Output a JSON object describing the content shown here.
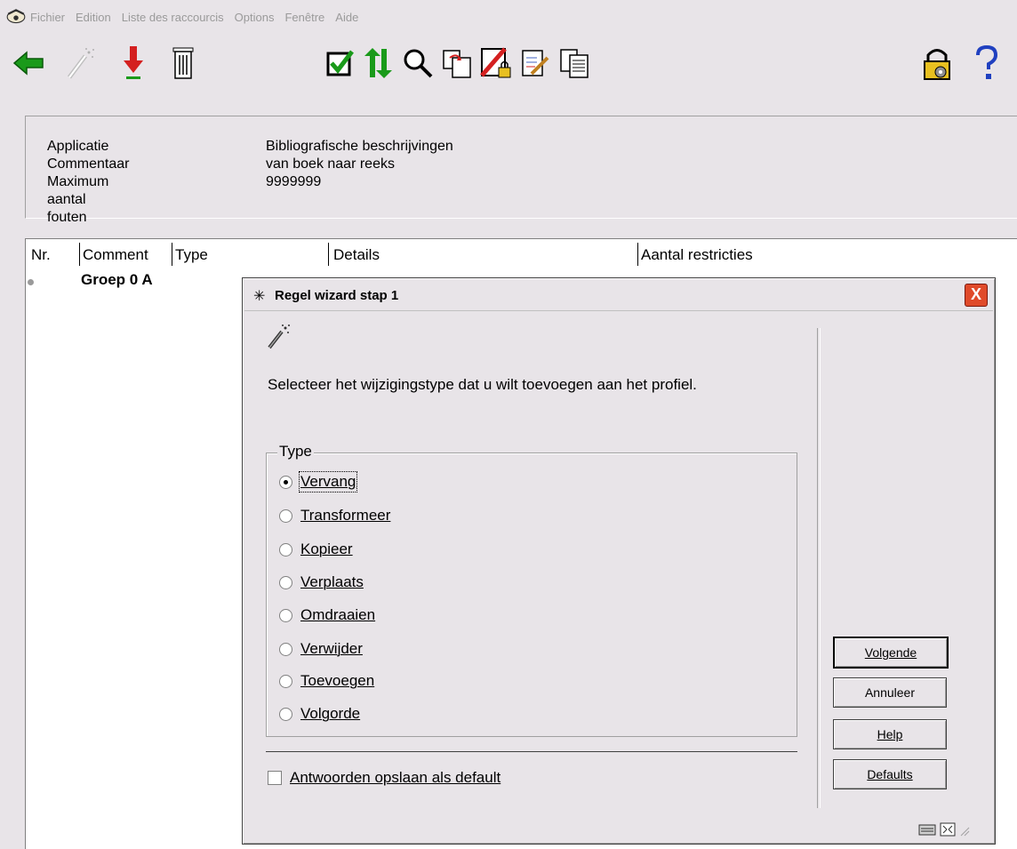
{
  "menubar": {
    "items": [
      "Fichier",
      "Edition",
      "Liste des raccourcis",
      "Options",
      "Fenêtre",
      "Aide"
    ]
  },
  "toolbar": {
    "left_icons": [
      "back-arrow-icon",
      "magic-wand-icon",
      "download-arrow-icon",
      "trash-icon"
    ],
    "center_icons": [
      "checkmark-icon",
      "sort-updown-icon",
      "search-icon",
      "copy-pages-icon",
      "lock-edit-icon",
      "edit-note-icon",
      "document-list-icon"
    ],
    "right_icons": [
      "lock-settings-icon",
      "help-icon"
    ]
  },
  "header": {
    "rows": [
      {
        "label": "Applicatie",
        "value": "Bibliografische beschrijvingen"
      },
      {
        "label": "Commentaar",
        "value": "van boek naar reeks"
      },
      {
        "label": "Maximum aantal fouten",
        "value": "9999999"
      }
    ]
  },
  "table": {
    "columns": [
      "Nr.",
      "Comment",
      "Type",
      "Details",
      "Aantal restricties"
    ],
    "group_label": "Groep 0 A"
  },
  "dialog": {
    "title": "Regel wizard stap 1",
    "close": "X",
    "prompt": "Selecteer het wijzigingstype dat u wilt toevoegen aan het profiel.",
    "group_title": "Type",
    "options": [
      "Vervang",
      "Transformeer",
      "Kopieer",
      "Verplaats",
      "Omdraaien",
      "Verwijder",
      "Toevoegen",
      "Volgorde"
    ],
    "selected_option": "Vervang",
    "checkbox_label": "Antwoorden opslaan als default",
    "checkbox_checked": false,
    "buttons": {
      "next": "Volgende",
      "cancel": "Annuleer",
      "help": "Help",
      "defaults": "Defaults"
    }
  },
  "colors": {
    "window_bg": "#e8e4e8",
    "close_button": "#e04a2a",
    "back_arrow": "#1a9a1a",
    "download_arrow": "#d42020"
  }
}
